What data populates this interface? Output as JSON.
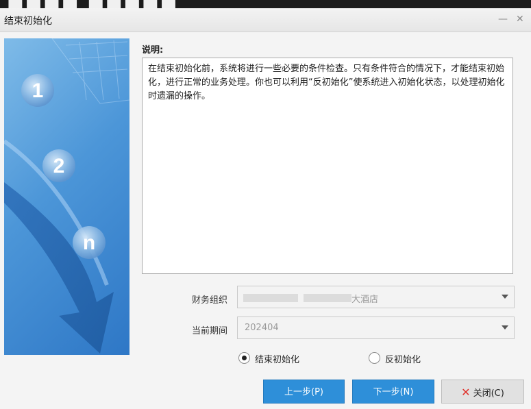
{
  "dialog": {
    "title": "结束初始化",
    "minimize_icon": "minus-icon",
    "close_icon": "close-icon"
  },
  "banner": {
    "steps": [
      "1",
      "2",
      "n"
    ]
  },
  "description": {
    "label": "说明:",
    "text": "在结束初始化前，系统将进行一些必要的条件检查。只有条件符合的情况下，才能结束初始化，进行正常的业务处理。你也可以利用“反初始化”使系统进入初始化状态，以处理初始化时遗漏的操作。"
  },
  "form": {
    "org_label": "财务组织",
    "org_value": "大酒店",
    "period_label": "当前期间",
    "period_value": "202404"
  },
  "options": {
    "end_init": "结束初始化",
    "reverse_init": "反初始化",
    "selected": "end_init"
  },
  "buttons": {
    "prev": "上一步(P)",
    "next": "下一步(N)",
    "close": "关闭(C)"
  },
  "colors": {
    "accent": "#2e8fd9",
    "close_x": "#e0302a"
  }
}
